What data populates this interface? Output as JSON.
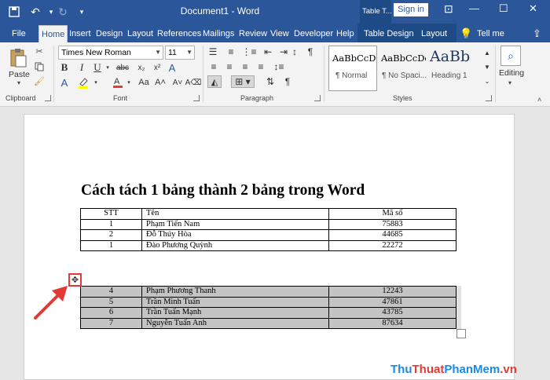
{
  "titlebar": {
    "title": "Document1  -  Word",
    "context_label": "Table T...",
    "signin_label": "Sign in",
    "icons": [
      "save-icon",
      "undo-icon",
      "undo-dropdown-icon",
      "redo-icon",
      "customize-qat-icon"
    ]
  },
  "tabs": [
    {
      "label": "File"
    },
    {
      "label": "Home",
      "active": true
    },
    {
      "label": "Insert"
    },
    {
      "label": "Design"
    },
    {
      "label": "Layout"
    },
    {
      "label": "References"
    },
    {
      "label": "Mailings"
    },
    {
      "label": "Review"
    },
    {
      "label": "View"
    },
    {
      "label": "Developer"
    },
    {
      "label": "Help"
    },
    {
      "label": "Table Design"
    },
    {
      "label": "Layout"
    }
  ],
  "tellme_label": "Tell me",
  "ribbon": {
    "clipboard": {
      "paste_label": "Paste",
      "group_label": "Clipboard"
    },
    "font": {
      "font_name": "Times New Roman",
      "font_size": "11",
      "group_label": "Font"
    },
    "paragraph": {
      "group_label": "Paragraph"
    },
    "styles": {
      "group_label": "Styles",
      "items": [
        {
          "sample": "AaBbCcDc",
          "name": "¶ Normal"
        },
        {
          "sample": "AaBbCcDc",
          "name": "¶ No Spaci..."
        },
        {
          "sample": "AaBb",
          "name": "Heading 1"
        }
      ]
    },
    "editing": {
      "label": "Editing"
    }
  },
  "document": {
    "heading": "Cách tách 1 bảng thành 2 bảng trong Word",
    "table1": {
      "headers": [
        "STT",
        "Tên",
        "Mã số"
      ],
      "rows": [
        [
          "1",
          "Phạm Tiến Nam",
          "75883"
        ],
        [
          "2",
          "Đỗ Thúy Hòa",
          "44685"
        ],
        [
          "1",
          "Đào Phương Quỳnh",
          "22272"
        ]
      ]
    },
    "table2": {
      "rows": [
        [
          "4",
          "Phạm Phương Thanh",
          "12243"
        ],
        [
          "5",
          "Trần Minh Tuấn",
          "47861"
        ],
        [
          "6",
          "Trần Tuấn Mạnh",
          "43785"
        ],
        [
          "7",
          "Nguyễn Tuấn Anh",
          "87634"
        ]
      ]
    }
  },
  "watermark": {
    "part1": "Thu",
    "part2": "Thuat",
    "part3": "PhanMem",
    "part4": ".vn"
  },
  "colors": {
    "accent": "#2b579a",
    "annotation": "#e53935",
    "selection": "#c4c4c4"
  }
}
